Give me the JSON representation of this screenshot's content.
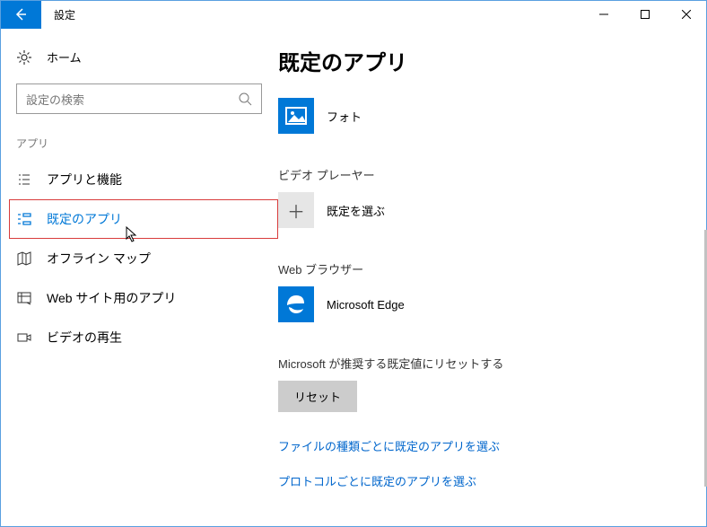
{
  "titlebar": {
    "title": "設定"
  },
  "sidebar": {
    "home": "ホーム",
    "search_placeholder": "設定の検索",
    "section": "アプリ",
    "items": [
      {
        "label": "アプリと機能"
      },
      {
        "label": "既定のアプリ"
      },
      {
        "label": "オフライン マップ"
      },
      {
        "label": "Web サイト用のアプリ"
      },
      {
        "label": "ビデオの再生"
      }
    ]
  },
  "main": {
    "heading": "既定のアプリ",
    "photos": {
      "label": "フォト"
    },
    "video": {
      "category": "ビデオ プレーヤー",
      "choose": "既定を選ぶ"
    },
    "browser": {
      "category": "Web ブラウザー",
      "app": "Microsoft Edge"
    },
    "reset": {
      "text": "Microsoft が推奨する既定値にリセットする",
      "button": "リセット"
    },
    "links": {
      "by_filetype": "ファイルの種類ごとに既定のアプリを選ぶ",
      "by_protocol": "プロトコルごとに既定のアプリを選ぶ"
    }
  }
}
